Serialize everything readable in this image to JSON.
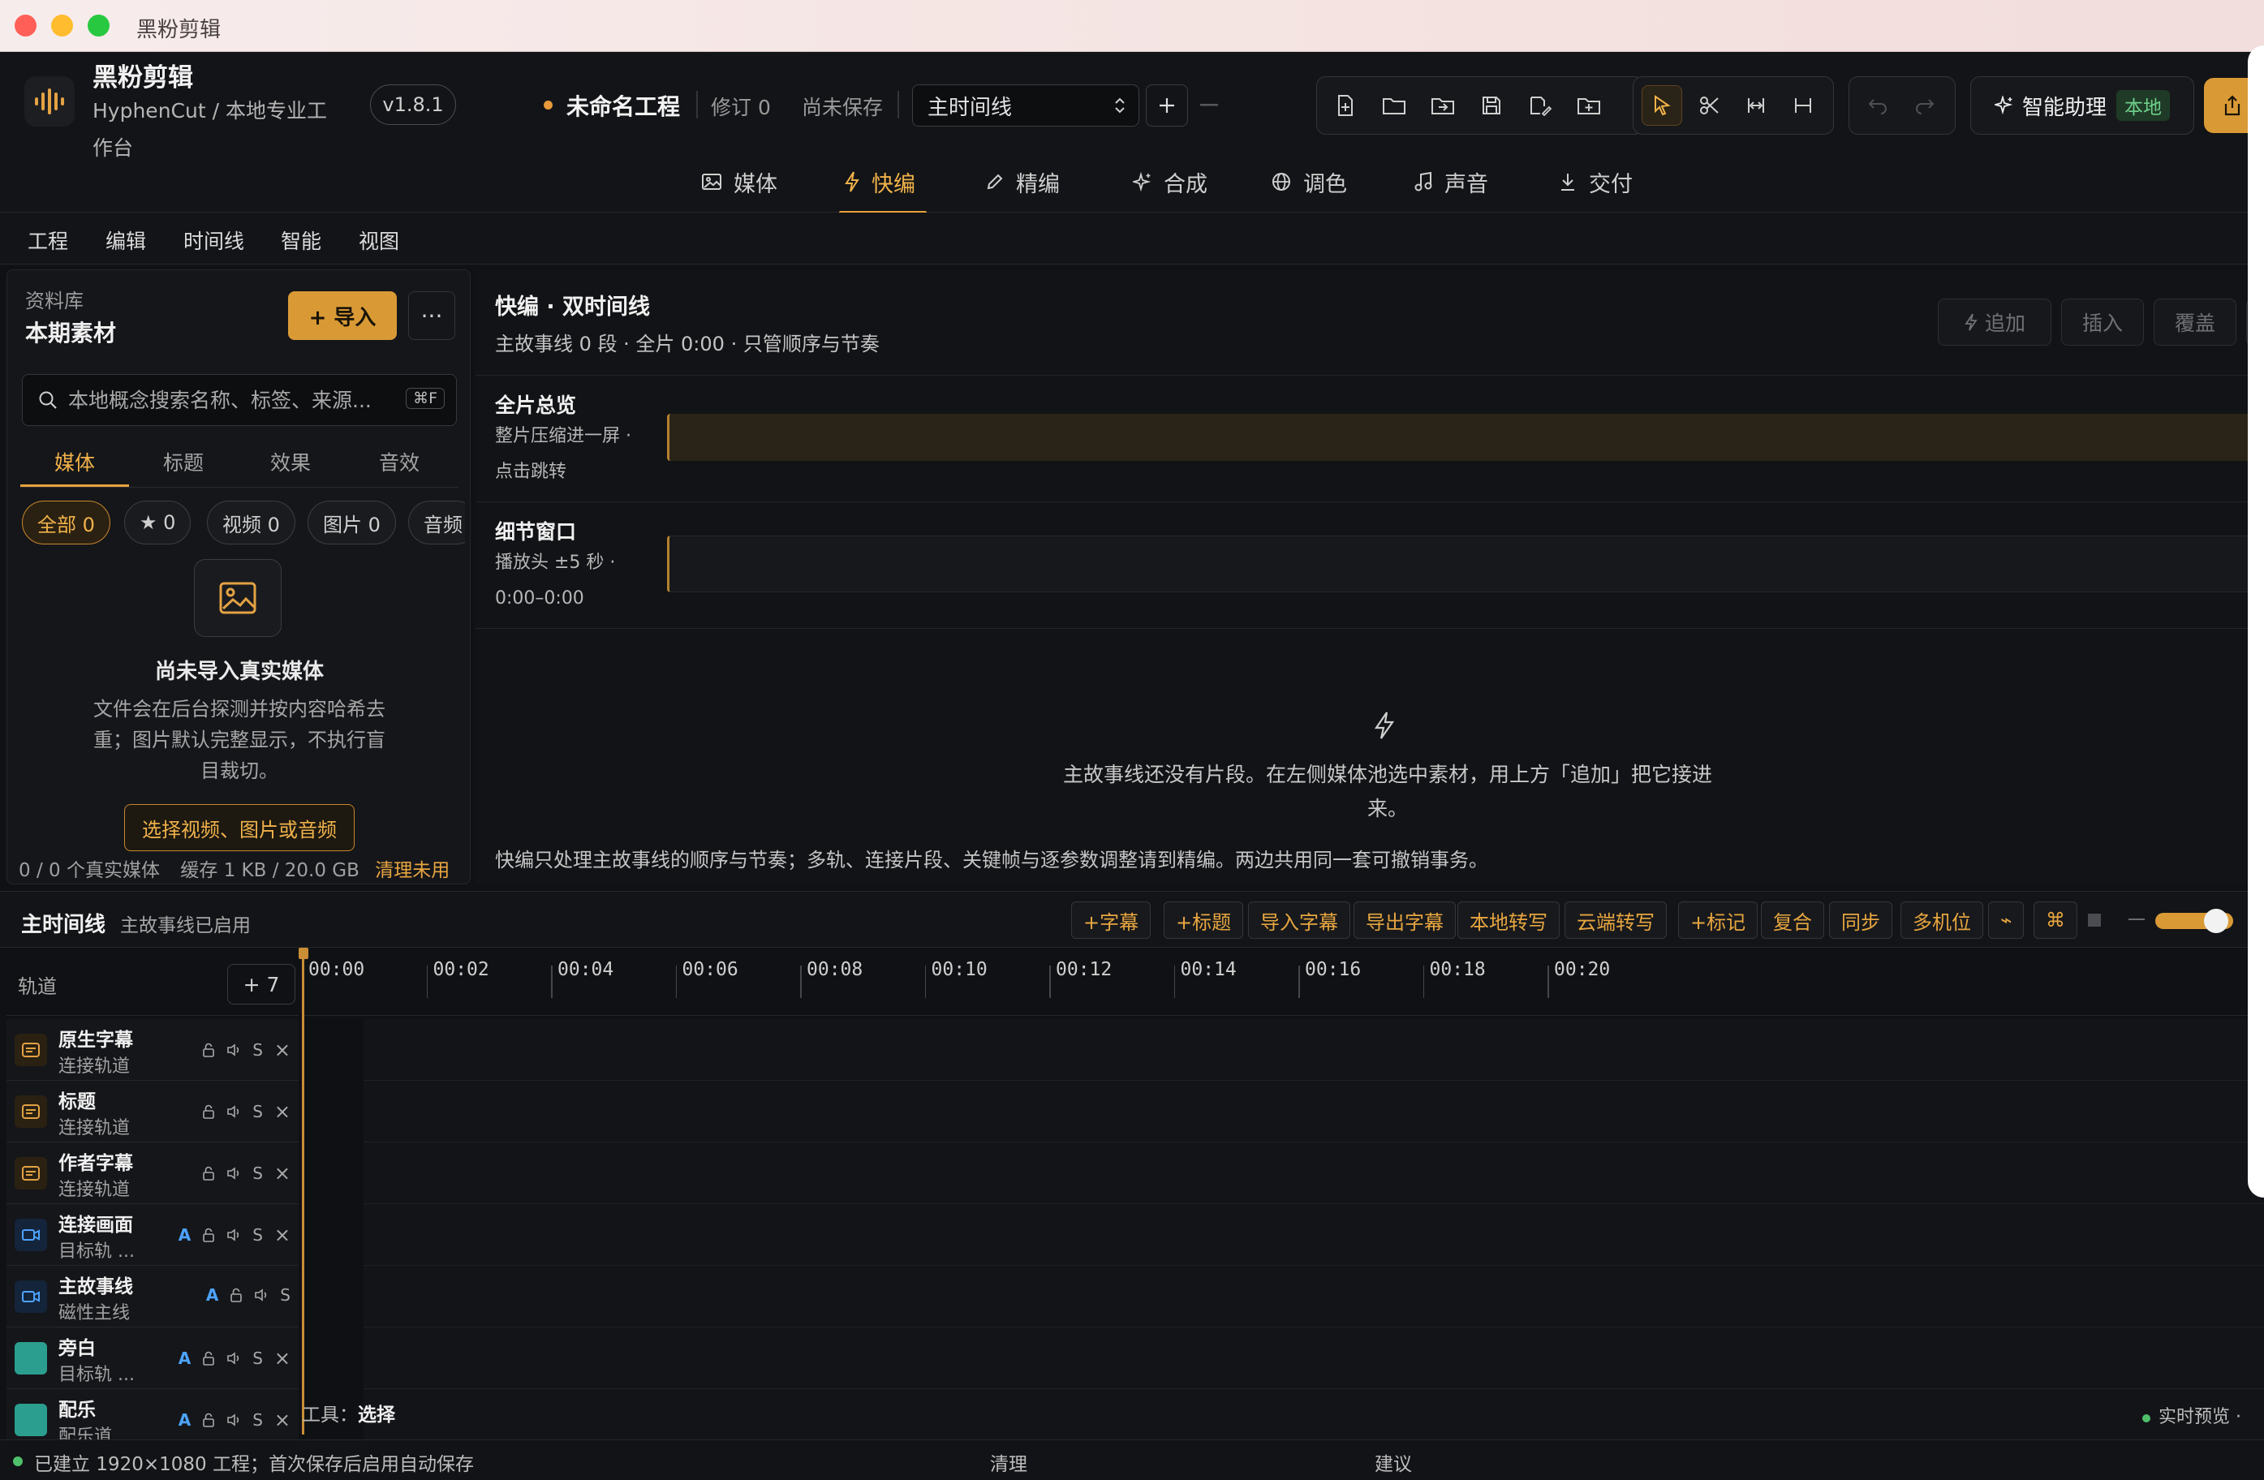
{
  "window": {
    "title": "黑粉剪辑"
  },
  "app": {
    "name": "黑粉剪辑",
    "subtitle": "HyphenCut / 本地专业工作台",
    "version": "v1.8.1"
  },
  "project": {
    "name": "未命名工程",
    "revision": "修订 0",
    "save_state": "尚未保存",
    "timeline_select": "主时间线"
  },
  "assistant": {
    "label": "智能助理",
    "badge": "本地"
  },
  "workspace_tabs": [
    {
      "label": "媒体",
      "icon": "image-icon"
    },
    {
      "label": "快编",
      "icon": "bolt-icon"
    },
    {
      "label": "精编",
      "icon": "pencil-icon"
    },
    {
      "label": "合成",
      "icon": "sparkle-icon"
    },
    {
      "label": "调色",
      "icon": "globe-icon"
    },
    {
      "label": "声音",
      "icon": "music-note-icon"
    },
    {
      "label": "交付",
      "icon": "download-icon"
    }
  ],
  "active_workspace": "快编",
  "menu": [
    "工程",
    "编辑",
    "时间线",
    "智能",
    "视图"
  ],
  "library": {
    "label": "资料库",
    "title": "本期素材",
    "import_label": "+ 导入",
    "more_label": "···",
    "search_placeholder": "本地概念搜索名称、标签、来源...",
    "search_shortcut": "⌘F",
    "tabs": [
      "媒体",
      "标题",
      "效果",
      "音效"
    ],
    "active_tab": "媒体",
    "filters": [
      {
        "label": "全部 0",
        "active": true
      },
      {
        "label": "★ 0",
        "active": false
      },
      {
        "label": "视频 0",
        "active": false
      },
      {
        "label": "图片 0",
        "active": false
      },
      {
        "label": "音频",
        "active": false
      }
    ],
    "empty_title": "尚未导入真实媒体",
    "empty_desc": "文件会在后台探测并按内容哈希去重；图片默认完整显示，不执行盲目裁切。",
    "choose_label": "选择视频、图片或音频",
    "footer_count": "0 / 0 个真实媒体",
    "footer_cache": "缓存 1 KB / 20.0 GB",
    "footer_clean": "清理未用"
  },
  "quick_edit": {
    "title": "快编 · 双时间线",
    "subtitle": "主故事线 0 段 · 全片 0:00 · 只管顺序与节奏",
    "actions": [
      "追加",
      "插入",
      "覆盖"
    ],
    "overview_label": "全片总览",
    "overview_desc": "整片压缩进一屏 · 点击跳转",
    "detail_label": "细节窗口",
    "detail_desc": "播放头 ±5 秒 · 0:00–0:00",
    "empty_text": "主故事线还没有片段。在左侧媒体池选中素材，用上方「追加」把它接进来。",
    "footnote": "快编只处理主故事线的顺序与节奏；多轨、连接片段、关键帧与逐参数调整请到精编。两边共用同一套可撤销事务。"
  },
  "timeline": {
    "title": "主时间线",
    "status": "主故事线已启用",
    "buttons": [
      "+字幕",
      "+标题",
      "导入字幕",
      "导出字幕",
      "本地转写",
      "云端转写",
      "+标记",
      "复合",
      "同步",
      "多机位",
      "⌁",
      "⌘"
    ],
    "zoom": 0.85,
    "tracks_label": "轨道",
    "add_track": "+ 7",
    "ticks": [
      "00:00",
      "00:02",
      "00:04",
      "00:06",
      "00:08",
      "00:10",
      "00:12",
      "00:14",
      "00:16",
      "00:18",
      "00:20"
    ],
    "tracks": [
      {
        "name": "原生字幕",
        "sub": "连接轨道",
        "type": "caption",
        "a": false,
        "ctrls": [
          "lock",
          "speaker",
          "S",
          "×"
        ]
      },
      {
        "name": "标题",
        "sub": "连接轨道",
        "type": "caption",
        "a": false,
        "ctrls": [
          "lock",
          "speaker",
          "S",
          "×"
        ]
      },
      {
        "name": "作者字幕",
        "sub": "连接轨道",
        "type": "caption",
        "a": false,
        "ctrls": [
          "lock",
          "speaker",
          "S",
          "×"
        ]
      },
      {
        "name": "连接画面",
        "sub": "目标轨 ...",
        "type": "video",
        "a": true,
        "ctrls": [
          "lock",
          "speaker",
          "S",
          "×"
        ]
      },
      {
        "name": "主故事线",
        "sub": "磁性主线",
        "type": "video",
        "a": true,
        "ctrls": [
          "lock",
          "speaker",
          "S"
        ]
      },
      {
        "name": "旁白",
        "sub": "目标轨 ...",
        "type": "audio",
        "a": true,
        "ctrls": [
          "lock",
          "speaker",
          "S",
          "×"
        ]
      },
      {
        "name": "配乐",
        "sub": "配乐道",
        "type": "audio",
        "a": true,
        "ctrls": [
          "lock",
          "speaker",
          "S",
          "×"
        ]
      }
    ],
    "tool_prefix": "工具：",
    "tool_value": "选择",
    "live_preview": "实时预览 ·"
  },
  "status": {
    "text": "已建立 1920×1080 工程；首次保存后启用自动保存",
    "clean": "清理",
    "suggest": "建议"
  },
  "colors": {
    "accent": "#d99a36",
    "accent_text": "#f0b24a",
    "ok": "#4fc06a",
    "a_badge": "#4da3ff"
  }
}
